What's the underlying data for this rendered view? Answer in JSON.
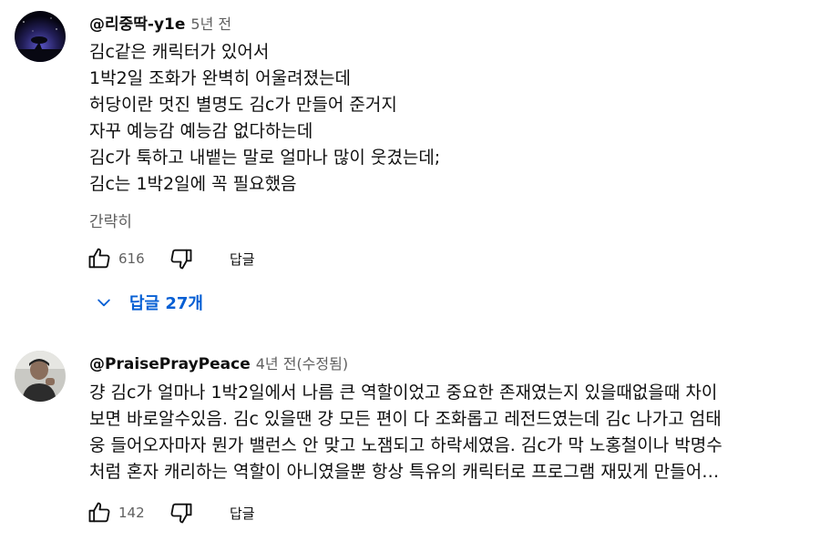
{
  "comments": [
    {
      "author": "@리중딱-y1e",
      "time": "5년 전",
      "lines": [
        "김c같은 캐릭터가 있어서",
        "1박2일 조화가 완벽히 어울려졌는데",
        "허당이란 멋진 별명도 김c가 만들어 준거지",
        "자꾸 예능감 예능감 없다하는데",
        "김c가 툭하고 내뱉는 말로 얼마나 많이 웃겼는데;",
        "김c는 1박2일에 꼭 필요했음"
      ],
      "collapse_label": "간략히",
      "likes": "616",
      "reply_label": "답글",
      "replies_label": "답글 27개"
    },
    {
      "author": "@PraisePrayPeace",
      "time": "4년 전(수정됨)",
      "lines": [
        "걍 김c가 얼마나 1박2일에서 나름 큰 역할이었고 중요한 존재였는지  있을때없을때 차이",
        "보면 바로알수있음. 김c 있을땐 걍 모든 편이 다 조화롭고 레전드였는데 김c 나가고 엄태",
        "웅 들어오자마자 뭔가 밸런스 안 맞고 노잼되고 하락세였음. 김c가 막 노홍철이나 박명수",
        "처럼 혼자 캐리하는 역할이 아니였을뿐 항상 특유의 캐릭터로 프로그램 재밌게 만들어…"
      ],
      "likes": "142",
      "reply_label": "답글"
    }
  ],
  "icons": {
    "like": "thumbs-up-icon",
    "dislike": "thumbs-down-icon",
    "expand": "chevron-down-icon"
  },
  "colors": {
    "link_blue": "#065fd4",
    "secondary_text": "#606060"
  }
}
